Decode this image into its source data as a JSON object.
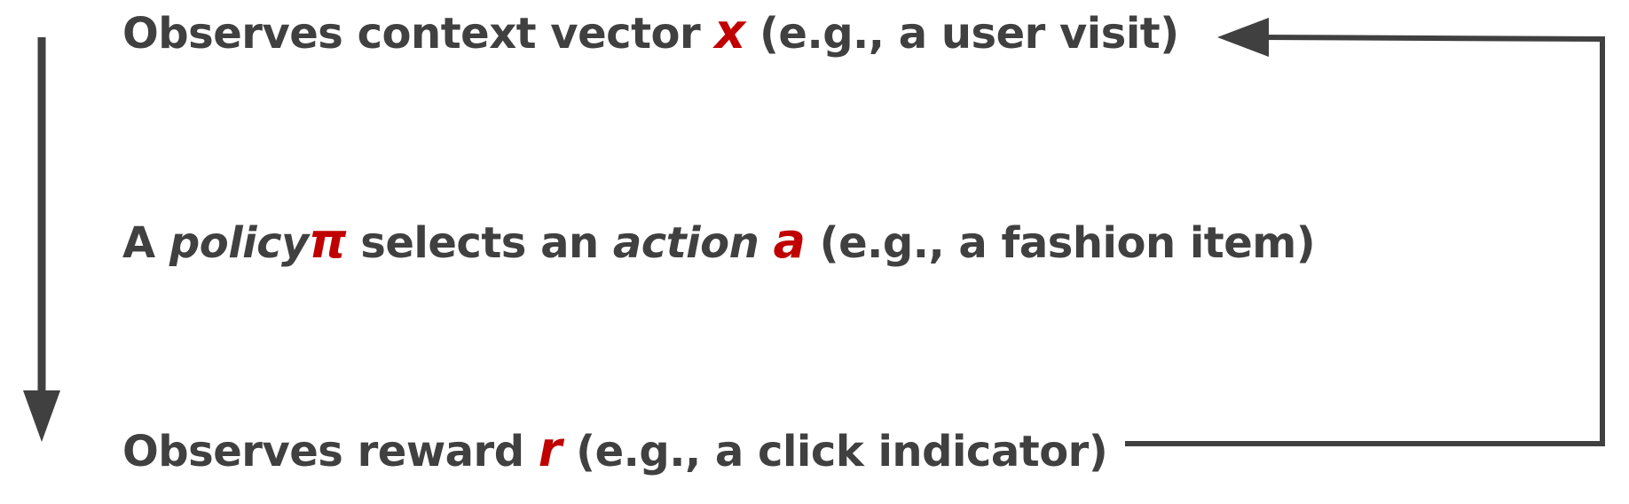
{
  "colors": {
    "text": "#404040",
    "symbol": "#c00000",
    "arrow": "#404040"
  },
  "steps": [
    {
      "before": "Observes context vector ",
      "symbol": "x",
      "after": " (e.g., a user visit)"
    },
    {
      "lead": "A ",
      "policy_word": "policy",
      "policy_symbol": "π",
      "middle": " selects an ",
      "action_word": "action",
      "action_symbol": "a",
      "after": " (e.g., a fashion item)"
    },
    {
      "before": "Observes reward ",
      "symbol": "r",
      "after": " (e.g., a click indicator)"
    }
  ],
  "icons": {
    "down_arrow": "arrow-down-icon",
    "loop_arrow": "loop-back-arrow-icon"
  }
}
